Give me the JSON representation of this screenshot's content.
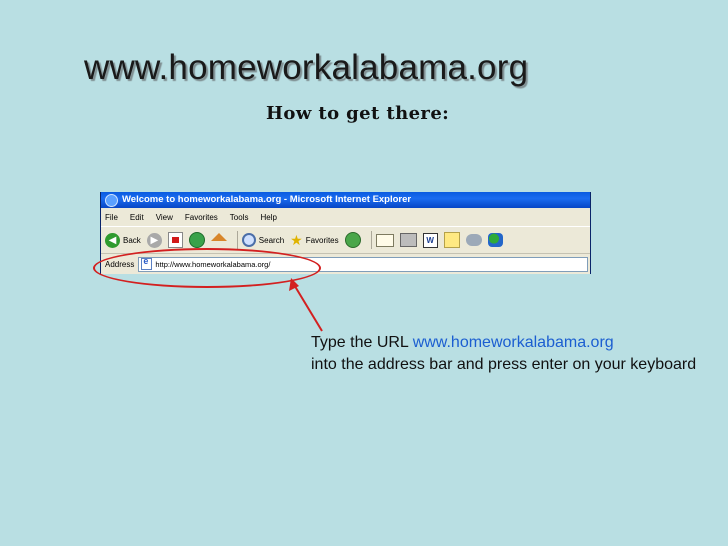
{
  "slide": {
    "title": "www.homeworkalabama.org",
    "subtitle": "How to get there:"
  },
  "browser": {
    "window_title": "Welcome to homeworkalabama.org - Microsoft Internet Explorer",
    "menu": [
      "File",
      "Edit",
      "View",
      "Favorites",
      "Tools",
      "Help"
    ],
    "toolbar": {
      "back_label": "Back",
      "search_label": "Search",
      "favorites_label": "Favorites"
    },
    "address": {
      "label": "Address",
      "value": "http://www.homeworkalabama.org/"
    }
  },
  "caption": {
    "prefix": "Type the URL ",
    "url": "www.homeworkalabama.org",
    "suffix": "into the address bar and press enter on your keyboard"
  },
  "colors": {
    "background": "#b9dfe3",
    "highlight": "#d32020",
    "link": "#1b5ed1",
    "titlebar": "#0a5be0"
  }
}
